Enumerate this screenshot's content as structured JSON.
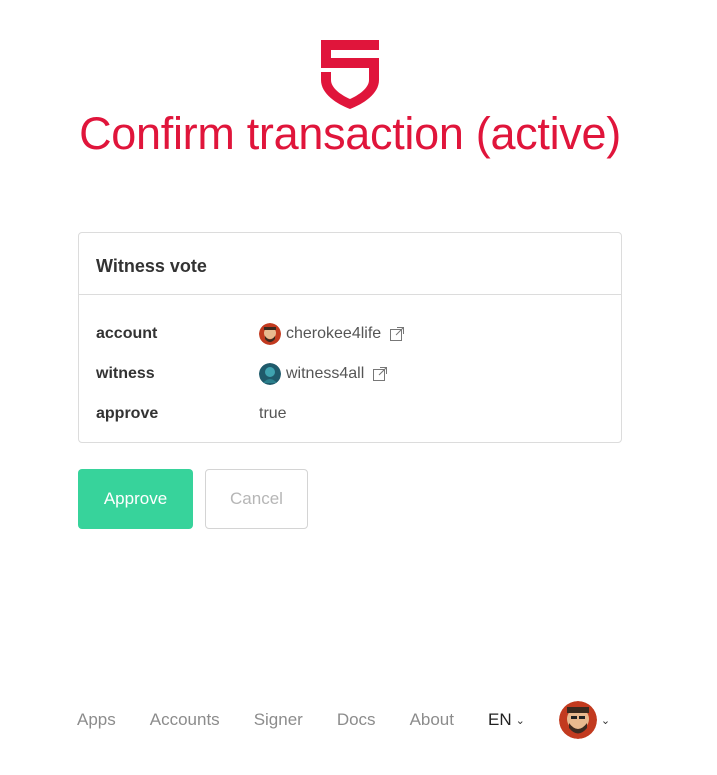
{
  "page": {
    "title": "Confirm transaction (active)",
    "accent_color": "#e0153b"
  },
  "card": {
    "header": "Witness vote",
    "rows": [
      {
        "label": "account",
        "value": "cherokee4life",
        "avatar": "user-avatar",
        "link_icon": "external-link-icon"
      },
      {
        "label": "witness",
        "value": "witness4all",
        "avatar": "user-avatar",
        "link_icon": "external-link-icon"
      },
      {
        "label": "approve",
        "value": "true"
      }
    ]
  },
  "actions": {
    "approve_label": "Approve",
    "cancel_label": "Cancel",
    "approve_color": "#37d39b"
  },
  "footer": {
    "links": [
      "Apps",
      "Accounts",
      "Signer",
      "Docs",
      "About"
    ],
    "language": "EN",
    "user_icon": "user-avatar"
  }
}
